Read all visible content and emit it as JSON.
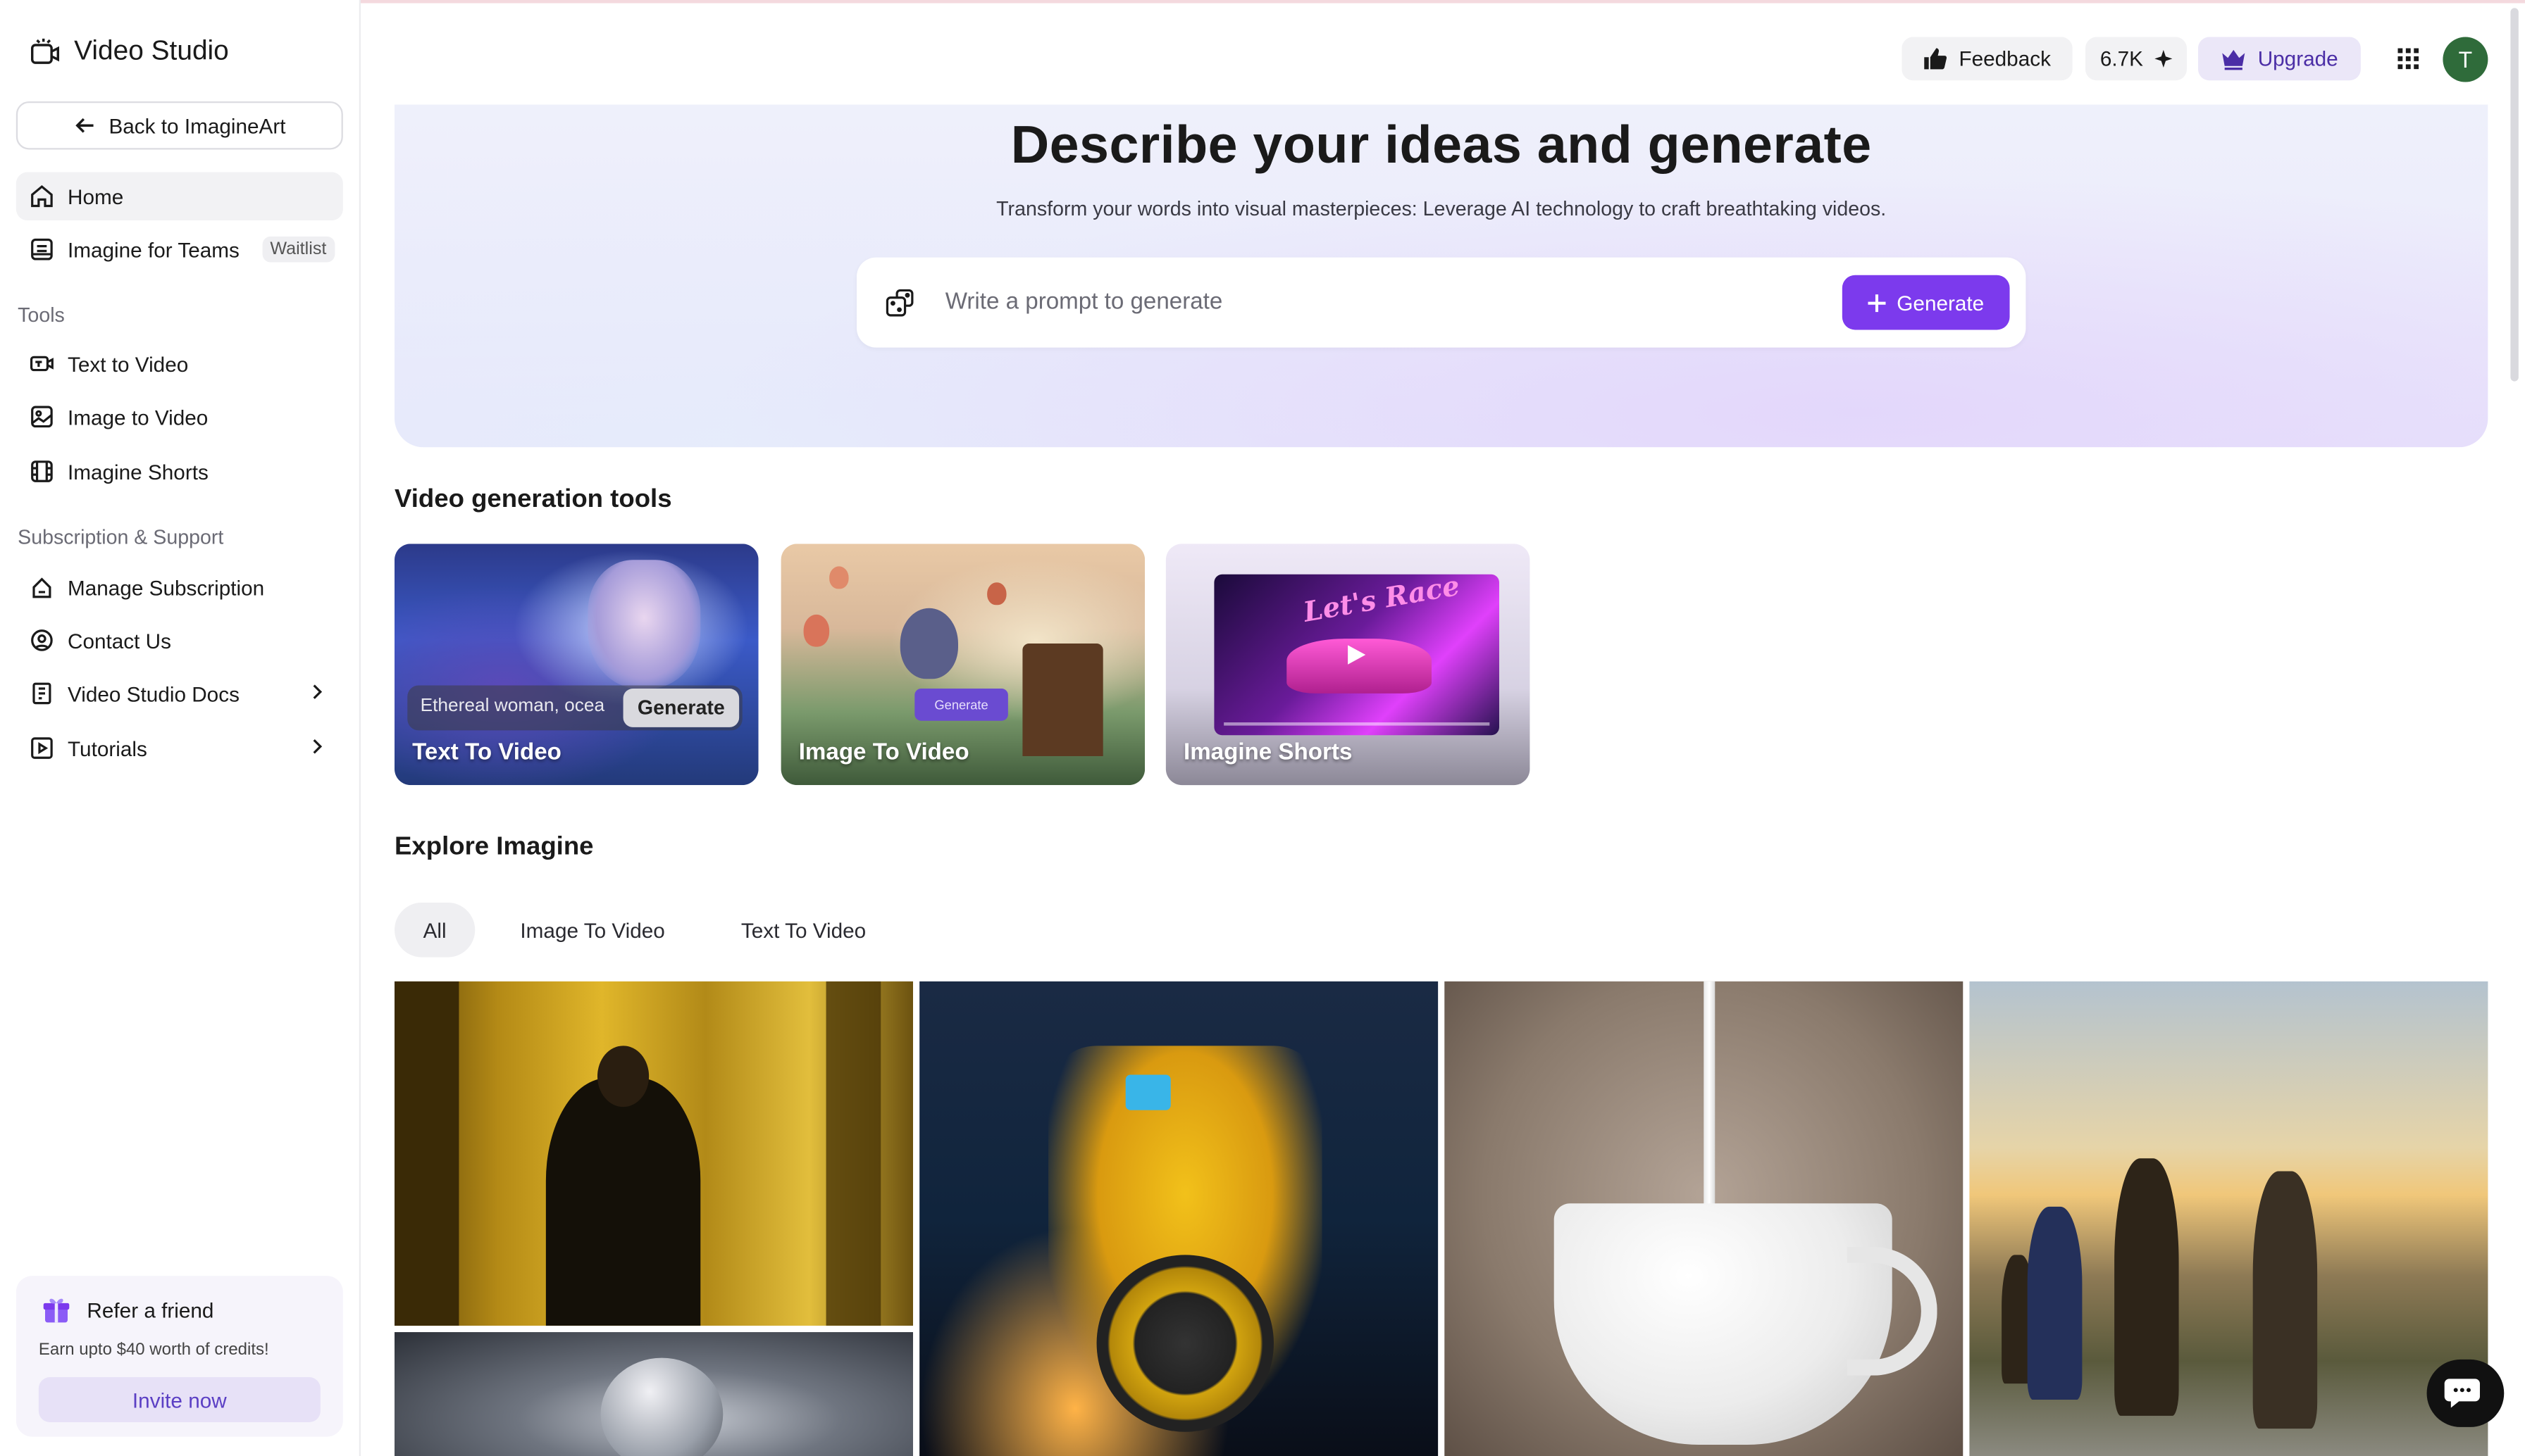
{
  "app": {
    "title": "Video Studio"
  },
  "sidebar": {
    "back_label": "Back to ImagineArt",
    "nav": [
      {
        "label": "Home"
      },
      {
        "label": "Imagine for Teams",
        "badge": "Waitlist"
      }
    ],
    "tools_label": "Tools",
    "tools": [
      {
        "label": "Text to Video"
      },
      {
        "label": "Image to Video"
      },
      {
        "label": "Imagine Shorts"
      }
    ],
    "support_label": "Subscription & Support",
    "support": [
      {
        "label": "Manage Subscription"
      },
      {
        "label": "Contact Us"
      },
      {
        "label": "Video Studio Docs"
      },
      {
        "label": "Tutorials"
      }
    ],
    "refer": {
      "title": "Refer a friend",
      "description": "Earn upto $40 worth of credits!",
      "button": "Invite now"
    }
  },
  "header": {
    "feedback": "Feedback",
    "credits": "6.7K",
    "upgrade": "Upgrade",
    "avatar_initial": "T"
  },
  "hero": {
    "title": "Describe your ideas and generate",
    "subtitle": "Transform your words into visual masterpieces: Leverage AI technology to craft breathtaking videos.",
    "prompt_placeholder": "Write a prompt to generate",
    "generate": "Generate"
  },
  "tools_section": {
    "title": "Video generation tools",
    "cards": [
      {
        "label": "Text To Video",
        "prompt_text": "Ethereal woman, ocea",
        "button": "Generate"
      },
      {
        "label": "Image To Video",
        "button": "Generate"
      },
      {
        "label": "Imagine Shorts",
        "screen_text": "Let's Race"
      }
    ]
  },
  "explore": {
    "title": "Explore Imagine",
    "filters": [
      {
        "label": "All",
        "active": true
      },
      {
        "label": "Image To Video",
        "active": false
      },
      {
        "label": "Text To Video",
        "active": false
      }
    ]
  },
  "colors": {
    "accent": "#7c3aed",
    "upgrade_bg": "#ebe7f8",
    "avatar": "#2f6b3a"
  }
}
